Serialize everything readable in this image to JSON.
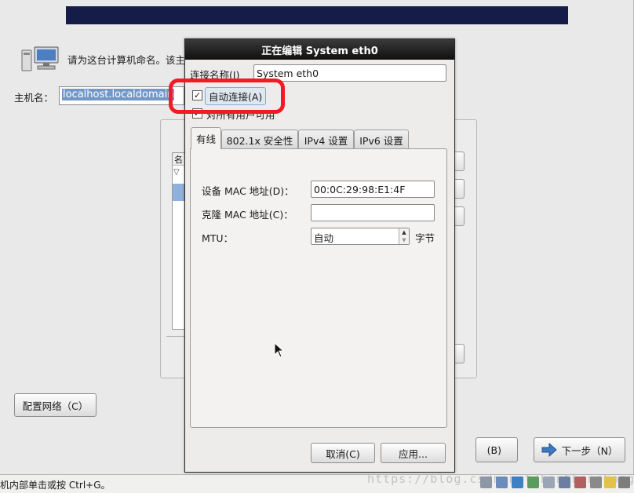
{
  "installer": {
    "hostname_prompt": "请为这台计算机命名。该主",
    "hostname_label": "主机名：",
    "hostname_value": "localhost.localdomain",
    "network_list_header": "名",
    "configure_network_button": "配置网络（C）",
    "back_button": "(B)",
    "next_button": "下一步（N）"
  },
  "dialog": {
    "title": "正在编辑 System eth0",
    "connection_name_label": "连接名称(I)",
    "connection_name_value": "System eth0",
    "auto_connect_label": "自动连接(A)",
    "auto_connect_checked": true,
    "all_users_label": "对所有用户可用",
    "all_users_checked": true,
    "tabs": [
      {
        "label": "有线",
        "active": true
      },
      {
        "label": "802.1x 安全性",
        "active": false
      },
      {
        "label": "IPv4 设置",
        "active": false
      },
      {
        "label": "IPv6 设置",
        "active": false
      }
    ],
    "wired": {
      "device_mac_label": "设备 MAC 地址(D)：",
      "device_mac_value": "00:0C:29:98:E1:4F",
      "cloned_mac_label": "克隆 MAC 地址(C)：",
      "cloned_mac_value": "",
      "mtu_label": "MTU：",
      "mtu_value": "自动",
      "mtu_unit": "字节"
    },
    "cancel_button": "取消(C)",
    "apply_button": "应用..."
  },
  "status_bar": {
    "text": "机内部单击或按 Ctrl+G。",
    "watermark": "https://blog.csdn.net/FanChongGong"
  },
  "colors": {
    "banner": "#151c47",
    "titlebar": "#1a1a1a",
    "selection": "#7398c8",
    "annotation": "#f21a25"
  },
  "icons": [
    "computer-icon",
    "check-icon",
    "arrow-right-icon",
    "spin-up-icon",
    "spin-down-icon",
    "mouse-cursor-icon"
  ]
}
